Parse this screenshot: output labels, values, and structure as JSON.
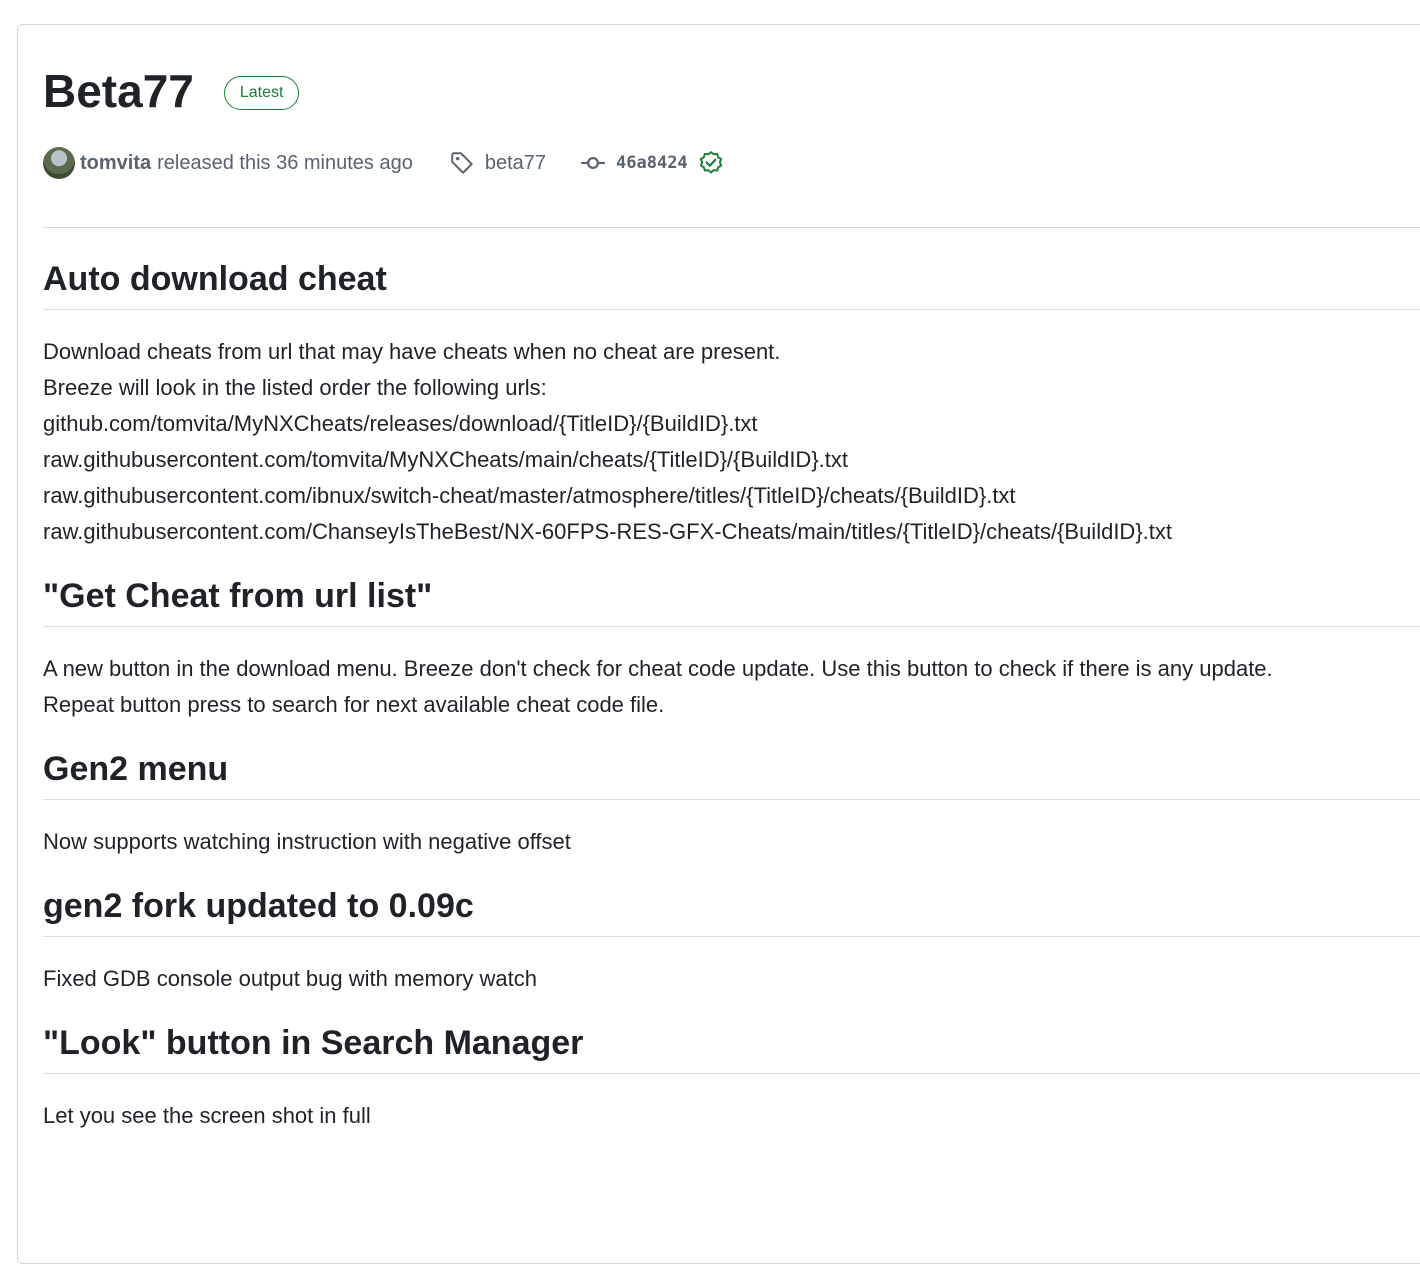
{
  "release": {
    "title": "Beta77",
    "badge": "Latest",
    "author": "tomvita",
    "released_text": "released this 36 minutes ago",
    "tag": "beta77",
    "commit": "46a8424"
  },
  "sections": [
    {
      "heading": "Auto download cheat",
      "lines": [
        "Download cheats from url that may have cheats when no cheat are present.",
        "Breeze will look in the listed order the following urls:",
        "github.com/tomvita/MyNXCheats/releases/download/{TitleID}/{BuildID}.txt",
        "raw.githubusercontent.com/tomvita/MyNXCheats/main/cheats/{TitleID}/{BuildID}.txt",
        "raw.githubusercontent.com/ibnux/switch-cheat/master/atmosphere/titles/{TitleID}/cheats/{BuildID}.txt",
        "raw.githubusercontent.com/ChanseyIsTheBest/NX-60FPS-RES-GFX-Cheats/main/titles/{TitleID}/cheats/{BuildID}.txt"
      ]
    },
    {
      "heading": "\"Get Cheat from url list\"",
      "lines": [
        "A new button in the download menu. Breeze don't check for cheat code update. Use this button to check if there is any update.",
        "Repeat button press to search for next available cheat code file."
      ]
    },
    {
      "heading": "Gen2 menu",
      "lines": [
        "Now supports watching instruction with negative offset"
      ]
    },
    {
      "heading": "gen2 fork updated to 0.09c",
      "lines": [
        "Fixed GDB console output bug with memory watch"
      ]
    },
    {
      "heading": "\"Look\" button in Search Manager",
      "lines": [
        "Let you see the screen shot in full"
      ]
    }
  ]
}
